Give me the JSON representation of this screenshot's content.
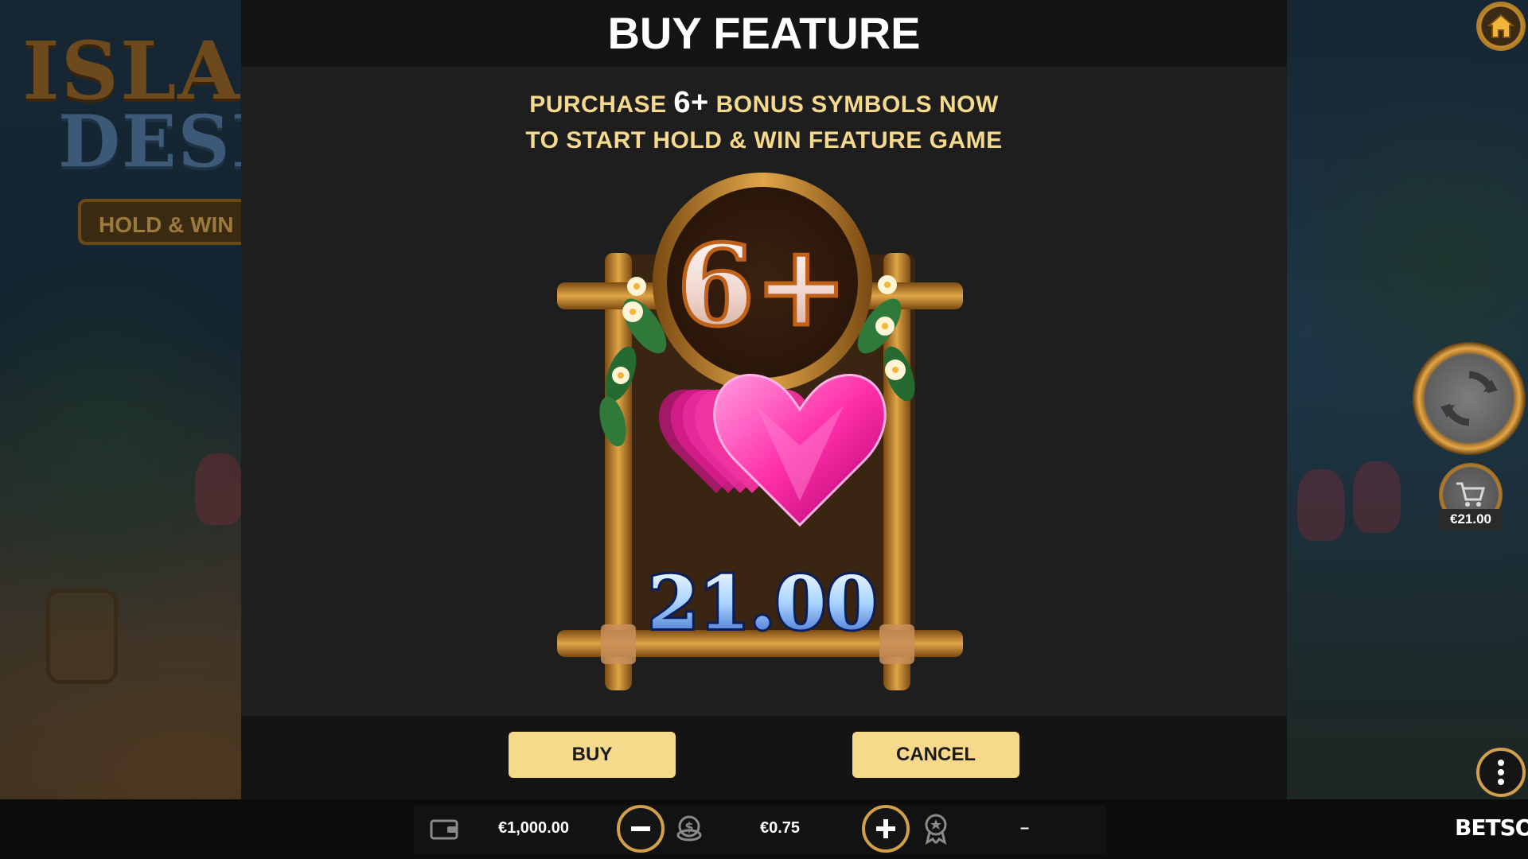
{
  "modal": {
    "title": "BUY FEATURE",
    "line1_pre": "PURCHASE",
    "line1_count": "6+",
    "line1_post": "BONUS SYMBOLS NOW",
    "line2": "TO START HOLD & WIN FEATURE GAME",
    "badge": "6+",
    "price": "21.00",
    "buy_label": "BUY",
    "cancel_label": "CANCEL"
  },
  "background": {
    "logo_line1": "ISLAND",
    "logo_line2": "DESIRE",
    "logo_badge": "HOLD & WIN"
  },
  "side_controls": {
    "buy_feature_price": "€21.00",
    "home_icon": "home-icon",
    "spin_icon": "refresh-icon",
    "cart_icon": "cart-icon",
    "menu_icon": "more-vertical-icon"
  },
  "bottom_bar": {
    "balance": "€1,000.00",
    "bet": "€0.75",
    "win": "–",
    "wallet_icon": "wallet-icon",
    "coins_icon": "coins-icon",
    "award_icon": "award-icon"
  },
  "brand": {
    "name": "BETSOFT"
  },
  "colors": {
    "accent_gold": "#f6d98a",
    "subtitle_gold": "#f5d98c",
    "modal_bg": "#1e1e1e",
    "gem_pink": "#ff3fb0"
  }
}
